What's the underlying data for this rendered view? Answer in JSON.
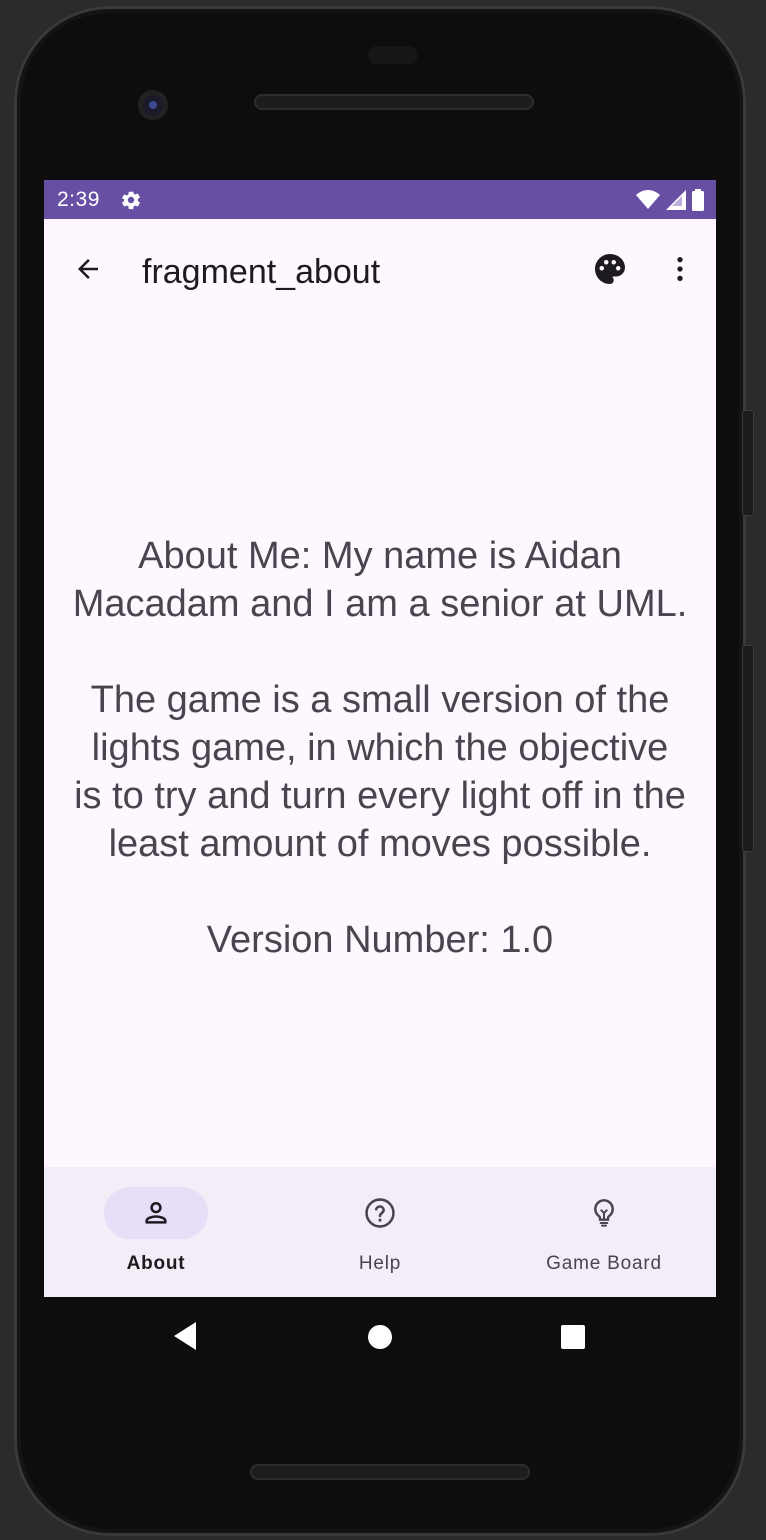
{
  "status_bar": {
    "time": "2:39",
    "background_color": "#6750a4",
    "icons": [
      "gear-icon",
      "wifi-icon",
      "signal-icon",
      "battery-icon"
    ]
  },
  "app_bar": {
    "title": "fragment_about",
    "back_icon": "arrow-back-icon",
    "actions": [
      "palette-icon",
      "more-vert-icon"
    ]
  },
  "content": {
    "about_line_1": "About Me: My name is Aidan",
    "about_line_2": "Macadam and I am a senior at UML.",
    "game_line_1": "The game is a small version of the",
    "game_line_2": "lights game, in which the objective",
    "game_line_3": "is to try and turn every light off in the",
    "game_line_4": "least amount of moves possible.",
    "version": "Version Number: 1.0"
  },
  "bottom_nav": {
    "items": [
      {
        "label": "About",
        "icon": "person-icon",
        "active": true
      },
      {
        "label": "Help",
        "icon": "help-circle-icon",
        "active": false
      },
      {
        "label": "Game Board",
        "icon": "lightbulb-icon",
        "active": false
      }
    ],
    "active_indicator_color": "#e8def8"
  },
  "system_nav": [
    "back-triangle-icon",
    "home-circle-icon",
    "recents-square-icon"
  ]
}
